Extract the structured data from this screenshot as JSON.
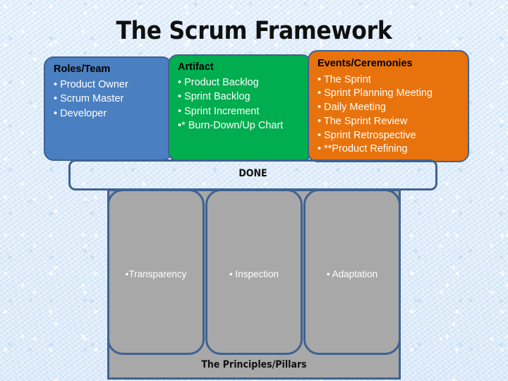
{
  "slide": {
    "title": "The Scrum Framework",
    "background_color": "#dfedfb",
    "border_color": "#3f6293"
  },
  "panels": [
    {
      "id": "roles",
      "heading": "Roles/Team",
      "color": "#4a7fc1",
      "items": [
        "• Product Owner",
        "• Scrum Master",
        "• Developer"
      ]
    },
    {
      "id": "artifact",
      "heading": "Artifact",
      "color": "#00ad4f",
      "items": [
        "• Product Backlog",
        "• Sprint Backlog",
        "• Sprint Increment",
        "•* Burn-Down/Up Chart"
      ]
    },
    {
      "id": "events",
      "heading": "Events/Ceremonies",
      "color": "#e8730c",
      "items": [
        "• The Sprint",
        "• Sprint Planning Meeting",
        "• Daily Meeting",
        "• The Sprint Review",
        "• Sprint Retrospective",
        "• **Product Refining"
      ]
    }
  ],
  "done_bar": {
    "label": "DONE"
  },
  "pillars": {
    "color": "#a8a8a8",
    "base_label": "The Principles/Pillars",
    "items": [
      {
        "label": "•Transparency"
      },
      {
        "label": "• Inspection"
      },
      {
        "label": "• Adaptation"
      }
    ]
  }
}
